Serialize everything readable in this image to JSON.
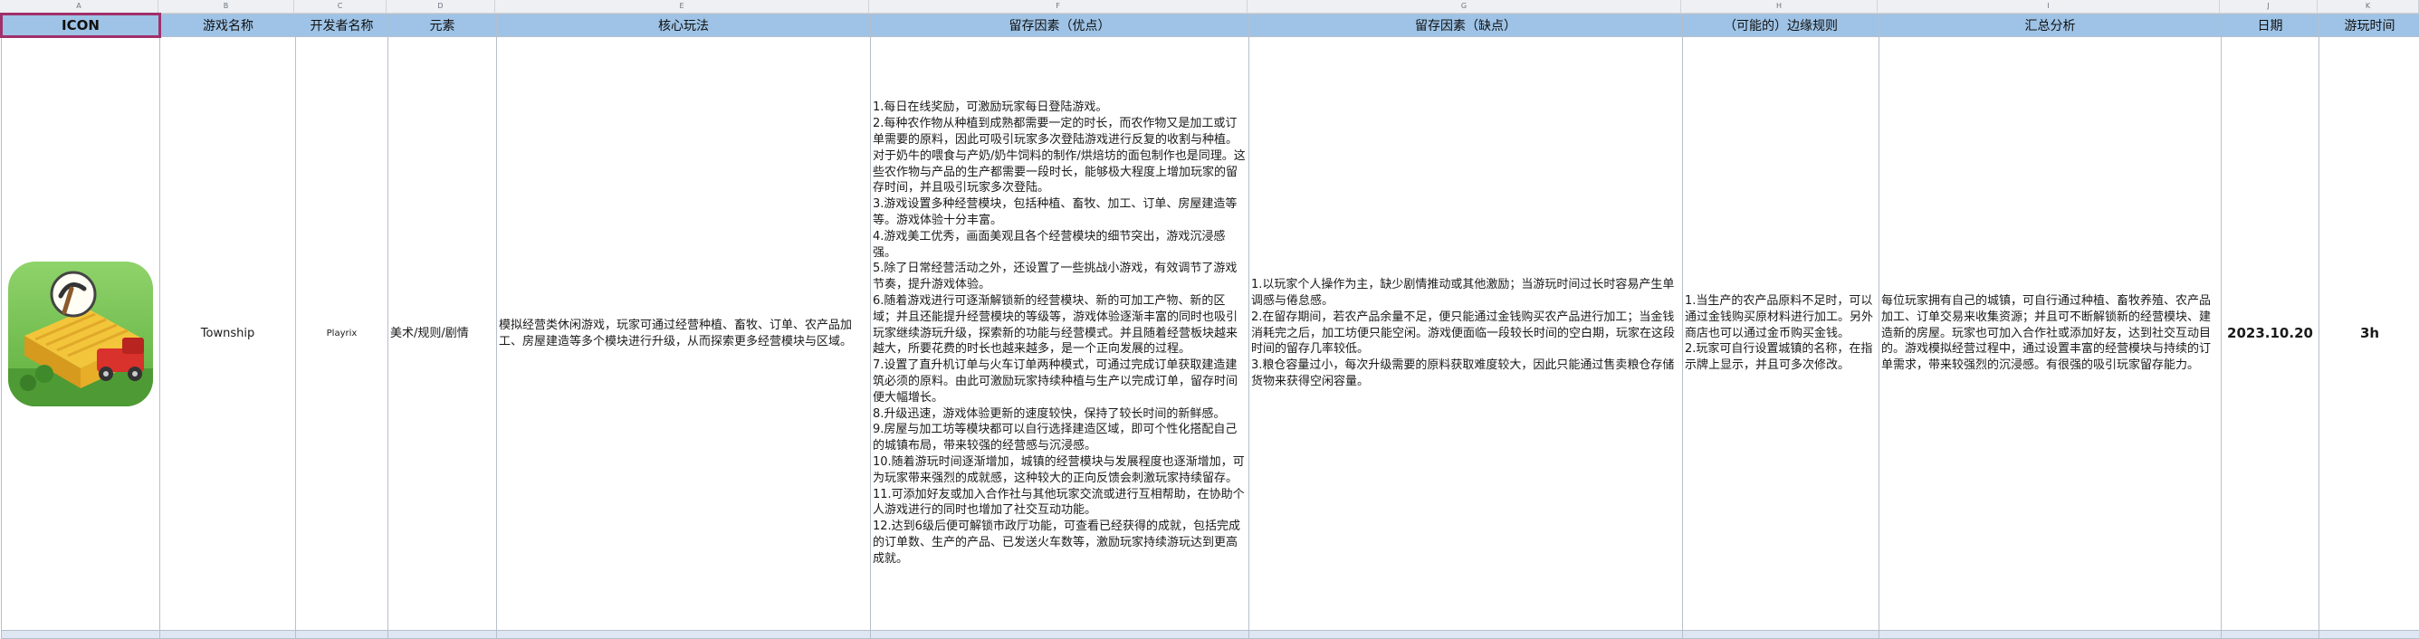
{
  "column_letters": [
    "A",
    "B",
    "C",
    "D",
    "E",
    "F",
    "G",
    "H",
    "I",
    "J",
    "K"
  ],
  "headers": [
    "ICON",
    "游戏名称",
    "开发者名称",
    "元素",
    "核心玩法",
    "留存因素（优点）",
    "留存因素（缺点）",
    "（可能的）边缘规则",
    "汇总分析",
    "日期",
    "游玩时间"
  ],
  "row": {
    "icon_name": "township-app-icon",
    "game_name": "Township",
    "developer": "Playrix",
    "elements": "美术/规则/剧情",
    "core_gameplay": "模拟经营类休闲游戏，玩家可通过经营种植、畜牧、订单、农产品加工、房屋建造等多个模块进行升级，从而探索更多经营模块与区域。",
    "pros": [
      "1.每日在线奖励，可激励玩家每日登陆游戏。",
      "2.每种农作物从种植到成熟都需要一定的时长，而农作物又是加工或订单需要的原料，因此可吸引玩家多次登陆游戏进行反复的收割与种植。对于奶牛的喂食与产奶/奶牛饲料的制作/烘焙坊的面包制作也是同理。这些农作物与产品的生产都需要一段时长，能够极大程度上增加玩家的留存时间，并且吸引玩家多次登陆。",
      "3.游戏设置多种经营模块，包括种植、畜牧、加工、订单、房屋建造等等。游戏体验十分丰富。",
      "4.游戏美工优秀，画面美观且各个经营模块的细节突出，游戏沉浸感强。",
      "5.除了日常经营活动之外，还设置了一些挑战小游戏，有效调节了游戏节奏，提升游戏体验。",
      "6.随着游戏进行可逐渐解锁新的经营模块、新的可加工产物、新的区域；并且还能提升经营模块的等级等，游戏体验逐渐丰富的同时也吸引玩家继续游玩升级，探索新的功能与经营模式。并且随着经营板块越来越大，所要花费的时长也越来越多，是一个正向发展的过程。",
      "7.设置了直升机订单与火车订单两种模式，可通过完成订单获取建造建筑必须的原料。由此可激励玩家持续种植与生产以完成订单，留存时间便大幅增长。",
      "8.升级迅速，游戏体验更新的速度较快，保持了较长时间的新鲜感。",
      "9.房屋与加工坊等模块都可以自行选择建造区域，即可个性化搭配自己的城镇布局，带来较强的经营感与沉浸感。",
      "10.随着游玩时间逐渐增加，城镇的经营模块与发展程度也逐渐增加，可为玩家带来强烈的成就感，这种较大的正向反馈会刺激玩家持续留存。",
      "11.可添加好友或加入合作社与其他玩家交流或进行互相帮助，在协助个人游戏进行的同时也增加了社交互动功能。",
      "12.达到6级后便可解锁市政厅功能，可查看已经获得的成就，包括完成的订单数、生产的产品、已发送火车数等，激励玩家持续游玩达到更高成就。"
    ],
    "cons": [
      "1.以玩家个人操作为主，缺少剧情推动或其他激励；当游玩时间过长时容易产生单调感与倦怠感。",
      "2.在留存期间，若农产品余量不足，便只能通过金钱购买农产品进行加工；当金钱消耗完之后，加工坊便只能空闲。游戏便面临一段较长时间的空白期，玩家在这段时间的留存几率较低。",
      "3.粮仓容量过小，每次升级需要的原料获取难度较大，因此只能通过售卖粮仓存储货物来获得空闲容量。"
    ],
    "edge_rules": [
      "1.当生产的农产品原料不足时，可以通过金钱购买原材料进行加工。另外商店也可以通过金币购买金钱。",
      "2.玩家可自行设置城镇的名称，在指示牌上显示，并且可多次修改。"
    ],
    "summary": "每位玩家拥有自己的城镇，可自行通过种植、畜牧养殖、农产品加工、订单交易来收集资源；并且可不断解锁新的经营模块、建造新的房屋。玩家也可加入合作社或添加好友，达到社交互动目的。游戏模拟经营过程中，通过设置丰富的经营模块与持续的订单需求，带来较强烈的沉浸感。有很强的吸引玩家留存能力。",
    "date": "2023.10.20",
    "playtime": "3h"
  }
}
